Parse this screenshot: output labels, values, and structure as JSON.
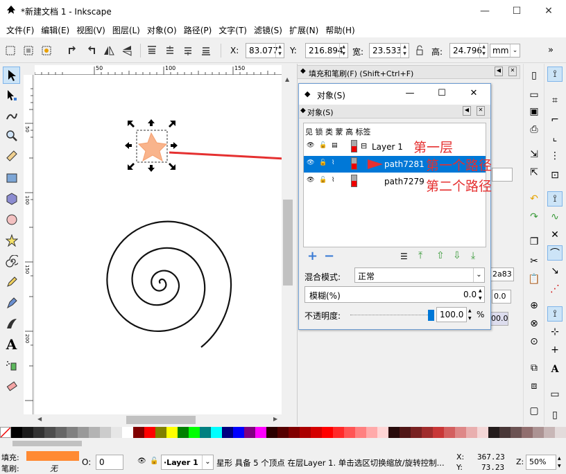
{
  "window": {
    "title": "*新建文档 1 - Inkscape",
    "minimize": "—",
    "maximize": "☐",
    "close": "✕"
  },
  "menu": [
    "文件(F)",
    "编辑(E)",
    "视图(V)",
    "图层(L)",
    "对象(O)",
    "路径(P)",
    "文字(T)",
    "滤镜(S)",
    "扩展(N)",
    "帮助(H)"
  ],
  "toolbar": {
    "x_label": "X:",
    "x_value": "83.077",
    "y_label": "Y:",
    "y_value": "216.894",
    "w_label": "宽:",
    "w_value": "23.533",
    "h_label": "高:",
    "h_value": "24.796",
    "unit": "mm",
    "more": "»"
  },
  "ruler": {
    "h_ticks": [
      "50",
      "100",
      "150"
    ],
    "v_ticks": [
      "50",
      "100",
      "150",
      "200"
    ]
  },
  "dock": {
    "title": "填充和笔刷(F) (Shift+Ctrl+F)",
    "value1": "2a83",
    "value2": "0.0",
    "value3": "00.0"
  },
  "objects_dialog": {
    "title": "对象(S)",
    "subtitle": "对象(S)",
    "columns": "见 锁 类 蒙 高 标签",
    "rows": [
      {
        "name": "Layer 1",
        "expand": "⊟"
      },
      {
        "name": "path7281",
        "selected": true
      },
      {
        "name": "path7279"
      }
    ],
    "add": "+",
    "remove": "−",
    "blend_label": "混合模式:",
    "blend_value": "正常",
    "blur_label": "模糊(%)",
    "blur_value": "0.0",
    "opacity_label": "不透明度:",
    "opacity_value": "100.0",
    "opacity_unit": "%",
    "opacity_fraction": 1.0
  },
  "annotations": {
    "layer": "第一层",
    "path1": "第一个路径",
    "path2": "第二个路径"
  },
  "statusbar": {
    "fill_label": "填充:",
    "stroke_label": "笔刷:",
    "stroke_value": "无",
    "o_label": "O:",
    "o_value": "0",
    "layer_value": "·Layer 1",
    "message": "星形 具备 5 个顶点 在层Layer 1. 单击选区切换缩放/旋转控制...",
    "x_label": "X:",
    "x_value": "367.23",
    "y_label": "Y:",
    "y_value": "73.23",
    "z_label": "Z:",
    "z_value": "50%"
  },
  "colors": {
    "accent": "#0078d7",
    "star_fill": "#f9b48c",
    "fill_swatch": "#ff8a33",
    "annotation": "#e53030"
  },
  "palette": [
    "#000000",
    "#1a1a1a",
    "#333333",
    "#4d4d4d",
    "#666666",
    "#808080",
    "#999999",
    "#b3b3b3",
    "#cccccc",
    "#e6e6e6",
    "#ffffff",
    "#800000",
    "#ff0000",
    "#808000",
    "#ffff00",
    "#008000",
    "#00ff00",
    "#008080",
    "#00ffff",
    "#000080",
    "#0000ff",
    "#800080",
    "#ff00ff",
    "#2b0000",
    "#550000",
    "#800000",
    "#aa0000",
    "#d40000",
    "#ff0000",
    "#ff2a2a",
    "#ff5555",
    "#ff8080",
    "#ffaaaa",
    "#ffd5d5",
    "#280b0b",
    "#501616",
    "#782121",
    "#a02c2c",
    "#c83737",
    "#d35f5f",
    "#de8787",
    "#e9afaf",
    "#f4d7d7",
    "#241c1c",
    "#483737",
    "#6c5353",
    "#916f6f",
    "#ac9393",
    "#c8b7b7",
    "#e3dbdb"
  ]
}
